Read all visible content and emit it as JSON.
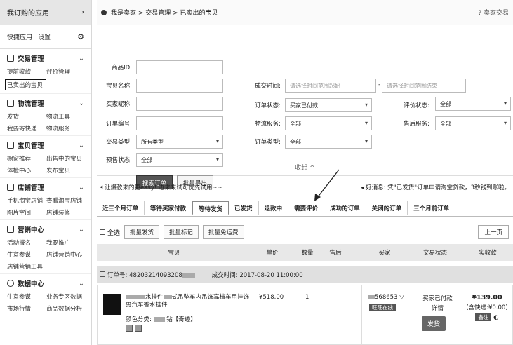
{
  "sidebar": {
    "my_apps": "我订购的应用",
    "quick_apps": "快捷应用",
    "settings": "设置",
    "sections": [
      {
        "title": "交易管理",
        "items": [
          "提前收款",
          "评价管理",
          "已卖出的宝贝",
          ""
        ]
      },
      {
        "title": "物流管理",
        "items": [
          "发货",
          "物流工具",
          "我要寄快递",
          "物流服务"
        ]
      },
      {
        "title": "宝贝管理",
        "items": [
          "橱窗推荐",
          "出售中的宝贝",
          "体检中心",
          "发布宝贝"
        ]
      },
      {
        "title": "店铺管理",
        "items": [
          "手机淘宝店铺",
          "查看淘宝店铺",
          "图片空间",
          "店铺装修"
        ]
      },
      {
        "title": "营销中心",
        "items": [
          "活动报名",
          "我要推广",
          "生意参谋",
          "店铺营销中心",
          "店铺营销工具",
          ""
        ]
      },
      {
        "title": "数据中心",
        "items": [
          "生意参谋",
          "业务专区数据",
          "市场行情",
          "商品数据分析"
        ]
      }
    ]
  },
  "breadcrumb": {
    "text": "我是卖家 > 交易管理 > 已卖出的宝贝",
    "help": "卖家交易"
  },
  "form": {
    "product_id": "商品ID:",
    "item_name": "宝贝名称:",
    "buyer_nick": "买家昵称:",
    "order_no": "订单编号:",
    "trade_type": "交易类型:",
    "trade_type_val": "所有类型",
    "presale": "预售状态:",
    "presale_val": "全部",
    "deal_time": "成交时间:",
    "time_start_ph": "请选择时间范围起始",
    "time_end_ph": "请选择时间范围结束",
    "order_status": "订单状态:",
    "order_status_val": "买家已付款",
    "logistics": "物流服务:",
    "logistics_val": "全部",
    "order_type": "订单类型:",
    "order_type_val": "全部",
    "review_status": "评价状态:",
    "review_status_val": "全部",
    "aftersale": "售后服务:",
    "aftersale_val": "全部",
    "search_btn": "搜索订单",
    "export_btn": "批量导出",
    "collapse": "收起 ^"
  },
  "promo": {
    "left": "让爆款来的更easy! 进来来试可优先试用~~",
    "right": "好消息: 凭\"已发货\"订单申请淘宝贷款，3秒钱到账啦。"
  },
  "tabs": [
    "近三个月订单",
    "等待买家付款",
    "等待发货",
    "已发货",
    "退款中",
    "需要评价",
    "成功的订单",
    "关闭的订单",
    "三个月前订单"
  ],
  "tools": {
    "select_all": "全选",
    "batch_ship": "批量发货",
    "batch_mark": "批量标记",
    "batch_free": "批量免运费",
    "prev": "上一页"
  },
  "table_head": [
    "宝贝",
    "单价",
    "数量",
    "售后",
    "买家",
    "交易状态",
    "实收款"
  ],
  "order": {
    "order_no": "订单号: 48203214093208",
    "deal_time": "成交时间: 2017-08-20 11:00:00",
    "title": "水挂件",
    "title2": "式吊坠车内吊饰高档车用挂饰",
    "title3": "男汽车香水挂件",
    "color": "颜色分类:",
    "color_val": "钻【奇迹】",
    "price": "¥518.00",
    "qty": "1",
    "buyer": "568653",
    "buyer_tag": "旺旺在线",
    "status": "买家已付款",
    "detail": "详情",
    "ship": "发货",
    "paid": "¥139.00",
    "shipping": "(含快递:¥0.00)",
    "memo": "备注"
  }
}
